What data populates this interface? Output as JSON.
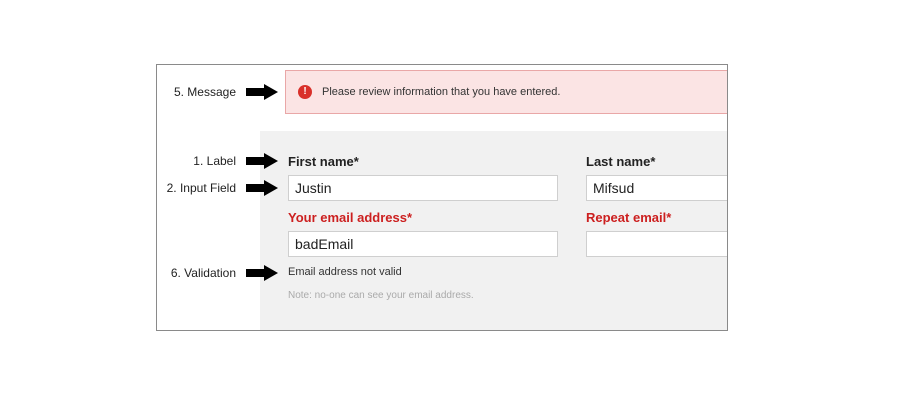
{
  "annotations": {
    "message": "5. Message",
    "label": "1. Label",
    "input_field": "2. Input Field",
    "validation": "6. Validation"
  },
  "message": {
    "icon": "exclamation-circle-icon",
    "text": "Please review information that you have entered."
  },
  "form": {
    "first_name": {
      "label": "First name",
      "required_mark": "*",
      "value": "Justin"
    },
    "last_name": {
      "label": "Last name",
      "required_mark": "*",
      "value": "Mifsud"
    },
    "email": {
      "label": "Your email address",
      "required_mark": "*",
      "value": "badEmail"
    },
    "repeat_email": {
      "label": "Repeat email",
      "required_mark": "*",
      "value": ""
    },
    "validation_message": "Email address not valid",
    "note": "Note: no-one can see your email address."
  },
  "colors": {
    "error_red": "#cc1f1f",
    "message_background": "#fbe4e4",
    "message_border": "#e9a7a7",
    "panel_background": "#f1f1f1"
  }
}
